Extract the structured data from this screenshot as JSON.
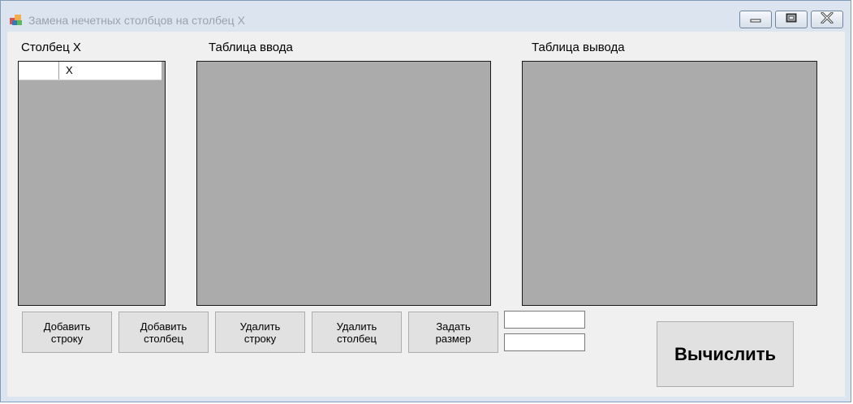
{
  "window": {
    "title": "Замена нечетных столбцов на столбец X",
    "controls": {
      "minimize": "minimize-icon",
      "maximize": "maximize-icon",
      "close": "close-icon"
    }
  },
  "labels": {
    "column_x": "Столбец X",
    "input_table": "Таблица ввода",
    "output_table": "Таблица вывода"
  },
  "column_x_grid": {
    "header": "X"
  },
  "buttons": {
    "add_row": "Добавить\nстроку",
    "add_column": "Добавить\nстолбец",
    "delete_row": "Удалить\nстроку",
    "delete_column": "Удалить\nстолбец",
    "set_size": "Задать\nразмер",
    "calculate": "Вычислить"
  },
  "inputs": {
    "size_1": "",
    "size_2": ""
  },
  "colors": {
    "grid_background": "#ababab",
    "form_background": "#f0f0f0",
    "button_background": "#e1e1e1",
    "title_bar": "#dbe4ef"
  }
}
